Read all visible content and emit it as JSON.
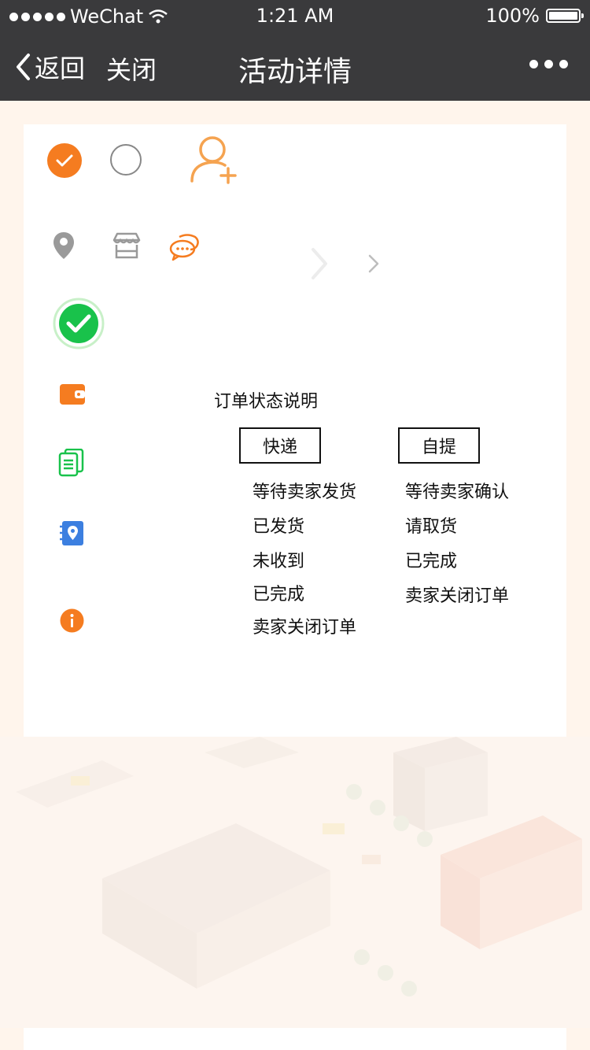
{
  "status_bar": {
    "carrier": "WeChat",
    "time": "1:21 AM",
    "battery": "100%"
  },
  "nav": {
    "back_label": "返回",
    "close_label": "关闭",
    "title": "活动详情"
  },
  "order_status": {
    "title": "订单状态说明",
    "express": {
      "label": "快递",
      "items": [
        "等待卖家发货",
        "已发货",
        "未收到",
        "已完成",
        "卖家关闭订单"
      ]
    },
    "pickup": {
      "label": "自提",
      "items": [
        "等待卖家确认",
        "请取货",
        "已完成",
        "卖家关闭订单"
      ]
    }
  },
  "colors": {
    "accent": "#f57c20",
    "success": "#19c24b",
    "navbar": "#3a3a3c"
  },
  "icons": [
    "check-circle-icon",
    "empty-circle-icon",
    "add-user-icon",
    "location-icon",
    "store-icon",
    "chat-icon",
    "chevron-right-icon",
    "success-check-icon",
    "wallet-icon",
    "document-icon",
    "address-book-icon",
    "info-icon"
  ]
}
